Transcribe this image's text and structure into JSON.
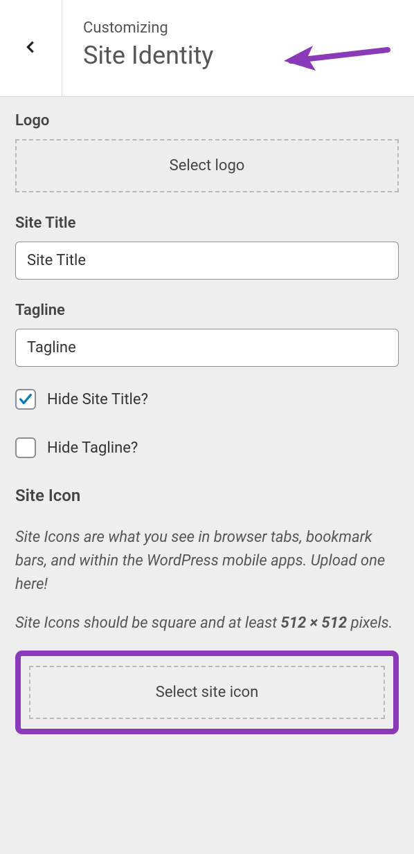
{
  "header": {
    "subtitle": "Customizing",
    "title": "Site Identity"
  },
  "logo": {
    "label": "Logo",
    "button": "Select logo"
  },
  "site_title": {
    "label": "Site Title",
    "value": "Site Title"
  },
  "tagline": {
    "label": "Tagline",
    "value": "Tagline"
  },
  "hide_site_title": {
    "label": "Hide Site Title?",
    "checked": true
  },
  "hide_tagline": {
    "label": "Hide Tagline?",
    "checked": false
  },
  "site_icon": {
    "heading": "Site Icon",
    "desc1": "Site Icons are what you see in browser tabs, bookmark bars, and within the WordPress mobile apps. Upload one here!",
    "desc2_a": "Site Icons should be square and at least ",
    "desc2_bold": "512 × 512",
    "desc2_b": " pixels.",
    "button": "Select site icon"
  },
  "annotation": {
    "arrow_color": "#8a3ab9"
  }
}
